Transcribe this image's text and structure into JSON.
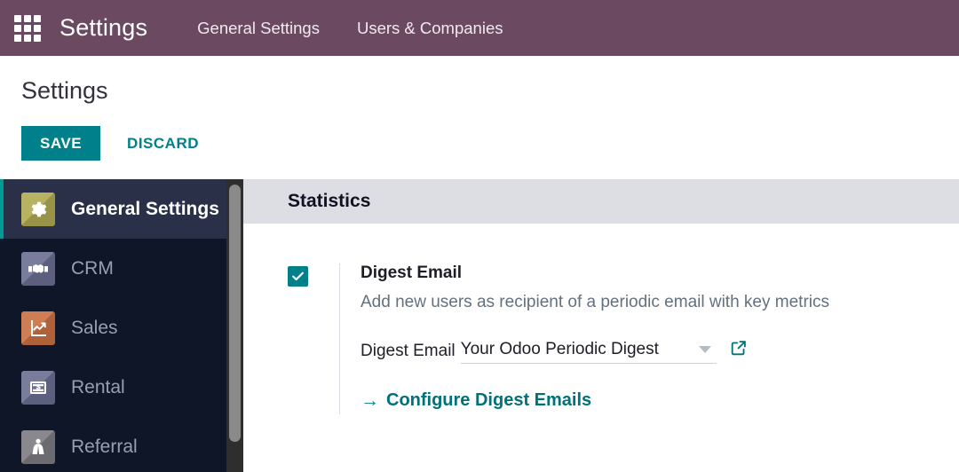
{
  "topbar": {
    "apps_icon": "apps-grid-icon",
    "brand": "Settings",
    "menus": [
      {
        "label": "General Settings"
      },
      {
        "label": "Users & Companies"
      }
    ],
    "background_color": "#6b4960"
  },
  "control_panel": {
    "title": "Settings",
    "save_label": "SAVE",
    "discard_label": "DISCARD",
    "save_color": "#00808a"
  },
  "sidebar": {
    "items": [
      {
        "label": "General Settings",
        "icon": "gear-icon",
        "icon_color": "#b0a951",
        "active": true
      },
      {
        "label": "CRM",
        "icon": "handshake-icon",
        "icon_color": "#6b6d91",
        "active": false
      },
      {
        "label": "Sales",
        "icon": "chart-growth-icon",
        "icon_color": "#c96f42",
        "active": false
      },
      {
        "label": "Rental",
        "icon": "rental-tag-icon",
        "icon_color": "#6b6d91",
        "active": false
      },
      {
        "label": "Referral",
        "icon": "referral-person-icon",
        "icon_color": "#7b7b80",
        "active": false
      }
    ],
    "active_accent_color": "#009a92"
  },
  "content": {
    "section_title": "Statistics",
    "digest": {
      "checked": true,
      "title": "Digest Email",
      "description": "Add new users as recipient of a periodic email with key metrics",
      "field_label": "Digest Email",
      "field_value": "Your Odoo Periodic Digest",
      "dropdown_icon": "chevron-down-icon",
      "external_link_icon": "external-link-icon",
      "configure_arrow": "→",
      "configure_label": "Configure Digest Emails"
    }
  }
}
